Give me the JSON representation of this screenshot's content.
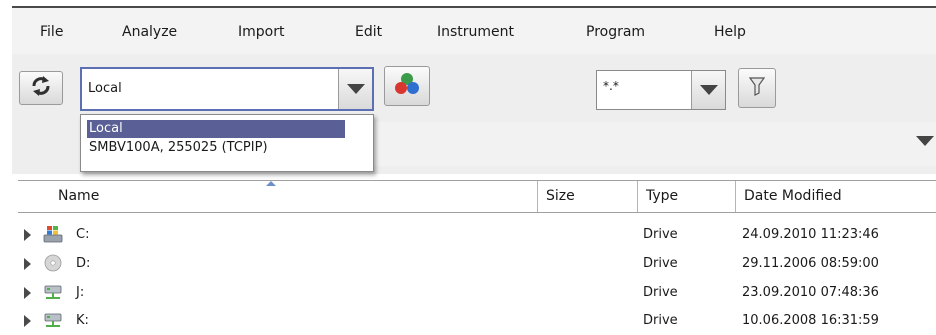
{
  "menu": [
    "File",
    "Analyze",
    "Import",
    "Edit",
    "Instrument",
    "Program",
    "Help"
  ],
  "toolbar": {
    "source_combo_value": "Local",
    "filter_combo_value": "*.*"
  },
  "source_dropdown": {
    "options": [
      "Local",
      "SMBV100A, 255025 (TCPIP)"
    ],
    "selected_index": 0
  },
  "file_table": {
    "columns": [
      "Name",
      "Size",
      "Type",
      "Date Modified"
    ],
    "rows": [
      {
        "name": "C:",
        "size": "",
        "type": "Drive",
        "date": "24.09.2010 11:23:46",
        "icon": "windows-drive-icon"
      },
      {
        "name": "D:",
        "size": "",
        "type": "Drive",
        "date": "29.11.2006 08:59:00",
        "icon": "cd-drive-icon"
      },
      {
        "name": "J:",
        "size": "",
        "type": "Drive",
        "date": "23.09.2010 07:48:36",
        "icon": "network-drive-icon"
      },
      {
        "name": "K:",
        "size": "",
        "type": "Drive",
        "date": "10.06.2008 16:31:59",
        "icon": "network-drive-icon"
      }
    ]
  }
}
